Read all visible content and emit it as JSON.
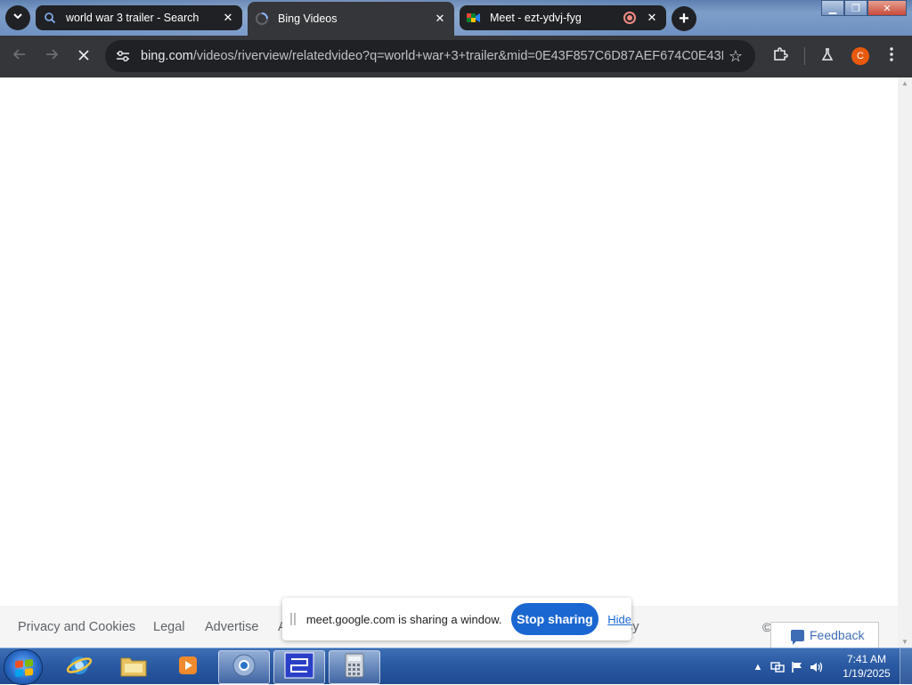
{
  "browser": {
    "tabs": [
      {
        "title": "world war 3 trailer - Search"
      },
      {
        "title": "Bing Videos"
      },
      {
        "title": "Meet - ezt-ydvj-fyg"
      }
    ],
    "omnibox": {
      "host": "bing.com",
      "path": "/videos/riverview/relatedvideo?q=world+war+3+trailer&mid=0E43F857C6D87AEF674C0E43F8..."
    },
    "profile_initial": "C"
  },
  "page": {
    "footer_links": [
      "Privacy and Cookies",
      "Legal",
      "Advertise",
      "A",
      "cy"
    ],
    "copyright": "©",
    "feedback_label": "Feedback"
  },
  "sharing_bar": {
    "message": "meet.google.com is sharing a window.",
    "stop_label": "Stop sharing",
    "hide_label": "Hide"
  },
  "taskbar": {
    "time": "7:41 AM",
    "date": "1/19/2025"
  },
  "colors": {
    "accent": "#1a67d2",
    "tab_bg": "#202124",
    "toolbar_bg": "#35363a",
    "profile": "#e8590c"
  }
}
